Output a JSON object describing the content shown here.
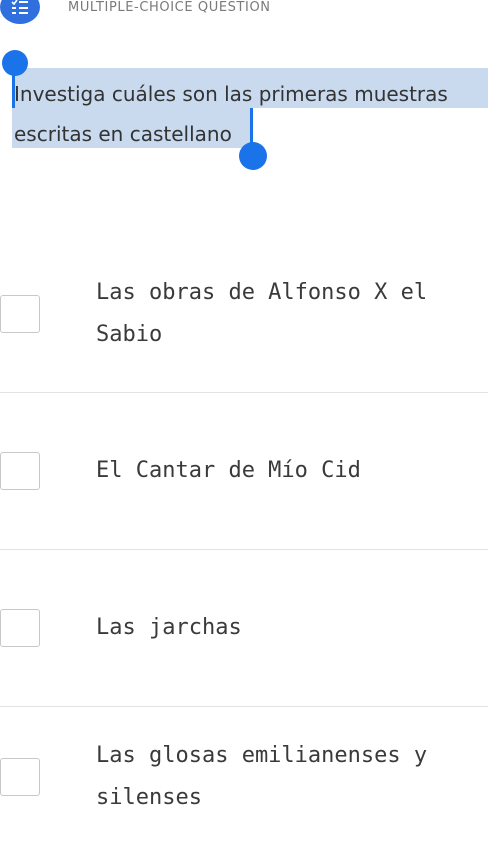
{
  "header": {
    "label": "MULTIPLE-CHOICE QUESTION",
    "icon": "list-check-icon",
    "icon_color": "#2f6fde"
  },
  "question": {
    "text": "Investiga cuáles son las primeras muestras escritas en castellano",
    "selection_color": "#c9d9ee",
    "handle_color": "#1a73e8"
  },
  "options": [
    {
      "label": "Las obras de Alfonso X el Sabio",
      "checked": false
    },
    {
      "label": "El Cantar de Mío Cid",
      "checked": false
    },
    {
      "label": "Las jarchas",
      "checked": false
    },
    {
      "label": "Las glosas emilianenses y silenses",
      "checked": false
    }
  ]
}
